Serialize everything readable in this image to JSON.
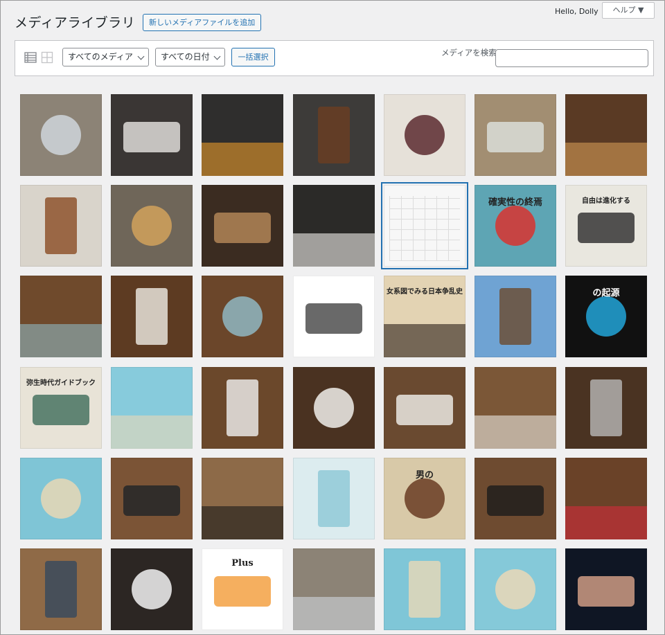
{
  "header": {
    "title": "メディアライブラリ",
    "add_new_label": "新しいメディアファイルを追加",
    "greeting": "Hello, Dolly",
    "help_label": "ヘルプ ▼"
  },
  "toolbar": {
    "filter_type_value": "すべてのメディア",
    "filter_date_value": "すべての日付",
    "bulk_select_label": "一括選択",
    "search_label": "メディアを検索"
  },
  "grid": {
    "tiles": [
      {
        "alt": "wine-decanter-spoon",
        "bg": "#8c8376",
        "accent": "#cfd6dc"
      },
      {
        "alt": "coffee-cup",
        "bg": "#3a3634",
        "accent": "#e9e6e2"
      },
      {
        "alt": "plated-dessert-slate",
        "bg": "#2f2e2d",
        "accent": "#e89a2a"
      },
      {
        "alt": "plated-dish-dark",
        "bg": "#3d3b39",
        "accent": "#6b3f22"
      },
      {
        "alt": "beef-plate",
        "bg": "#e6e1d9",
        "accent": "#5a2a2f"
      },
      {
        "alt": "fish-plate",
        "bg": "#a28e72",
        "accent": "#dfe4df"
      },
      {
        "alt": "bread-board",
        "bg": "#5a3a24",
        "accent": "#d29a55"
      },
      {
        "alt": "pork-plate",
        "bg": "#d9d4cb",
        "accent": "#8a4b23"
      },
      {
        "alt": "soup-bowl",
        "bg": "#6f6659",
        "accent": "#d2a25c"
      },
      {
        "alt": "skewer-board",
        "bg": "#3b2c21",
        "accent": "#b98b5a"
      },
      {
        "alt": "menu-card",
        "bg": "#2b2a28",
        "accent": "#f0efe9"
      },
      {
        "alt": "screenshot-calendar",
        "bg": "#f7f7f7",
        "accent": "#dcdcdc",
        "selected": true
      },
      {
        "alt": "book-cover-apple",
        "bg": "#5ea5b4",
        "accent": "#d8322f",
        "title": "確実性の終焉"
      },
      {
        "alt": "book-cover-freedom",
        "bg": "#e9e7df",
        "accent": "#2b2b2b",
        "title": "自由は進化する"
      },
      {
        "alt": "books-on-table-1",
        "bg": "#6f4a2c",
        "accent": "#8fb7c2"
      },
      {
        "alt": "books-on-table-2",
        "bg": "#5d3b22",
        "accent": "#f0eee6"
      },
      {
        "alt": "books-on-table-3",
        "bg": "#6b462a",
        "accent": "#8fb7c2"
      },
      {
        "alt": "family-tree-chart",
        "bg": "#ffffff",
        "accent": "#444444"
      },
      {
        "alt": "book-cover-women",
        "bg": "#e3d3b3",
        "accent": "#2b2018",
        "title": "女系図でみる日本争乱史"
      },
      {
        "alt": "yayoi-tower",
        "bg": "#6fa3d3",
        "accent": "#6b4a2e"
      },
      {
        "alt": "book-cover-moral",
        "bg": "#111111",
        "accent": "#22a4d8",
        "title": "の起源"
      },
      {
        "alt": "book-cover-yayoi",
        "bg": "#e8e3d7",
        "accent": "#3d6b5a",
        "title": "弥生時代ガイドブック"
      },
      {
        "alt": "beach-sand",
        "bg": "#87cbdc",
        "accent": "#e9d9b8"
      },
      {
        "alt": "books-moral",
        "bg": "#6b482b",
        "accent": "#f1f1f1"
      },
      {
        "alt": "coffee-filter",
        "bg": "#4a3221",
        "accent": "#f0eeea"
      },
      {
        "alt": "coffee-filter-2",
        "bg": "#6a4a30",
        "accent": "#f2f1ee"
      },
      {
        "alt": "filter-frames",
        "bg": "#7b5737",
        "accent": "#e9e6e0"
      },
      {
        "alt": "kettle-drip",
        "bg": "#4a3322",
        "accent": "#b8b8b8"
      },
      {
        "alt": "beach-2",
        "bg": "#7fc5d6",
        "accent": "#e8d7b5"
      },
      {
        "alt": "phone-grip",
        "bg": "#7b5436",
        "accent": "#1f2328"
      },
      {
        "alt": "product-box",
        "bg": "#8d6a48",
        "accent": "#1b1b1b"
      },
      {
        "alt": "webpage-beach",
        "bg": "#dcecef",
        "accent": "#8cc8d6"
      },
      {
        "alt": "book-cover-painting",
        "bg": "#d8c9a8",
        "accent": "#6a3c23",
        "title": "男の"
      },
      {
        "alt": "phone-tripod-drip",
        "bg": "#6e4b30",
        "accent": "#1c1c1c"
      },
      {
        "alt": "tripod-red",
        "bg": "#6a4228",
        "accent": "#d22c3b"
      },
      {
        "alt": "phone-holder",
        "bg": "#8f6a47",
        "accent": "#34495e"
      },
      {
        "alt": "phone-clamp-box",
        "bg": "#2c2623",
        "accent": "#f2f2f2"
      },
      {
        "alt": "plugin-banner",
        "bg": "#ffffff",
        "accent": "#f29b37",
        "title": "Plus"
      },
      {
        "alt": "wine-decanter-spoon-2",
        "bg": "#8c8376",
        "accent": "#cfd6dc"
      },
      {
        "alt": "beach-3",
        "bg": "#7fc6d7",
        "accent": "#ead8b6"
      },
      {
        "alt": "beach-4",
        "bg": "#85c9d9",
        "accent": "#ead8b6"
      },
      {
        "alt": "singer-stage",
        "bg": "#0f1624",
        "accent": "#d9a48a"
      }
    ]
  },
  "icons": {
    "list_view": "list-view-icon",
    "grid_view": "grid-view-icon"
  }
}
